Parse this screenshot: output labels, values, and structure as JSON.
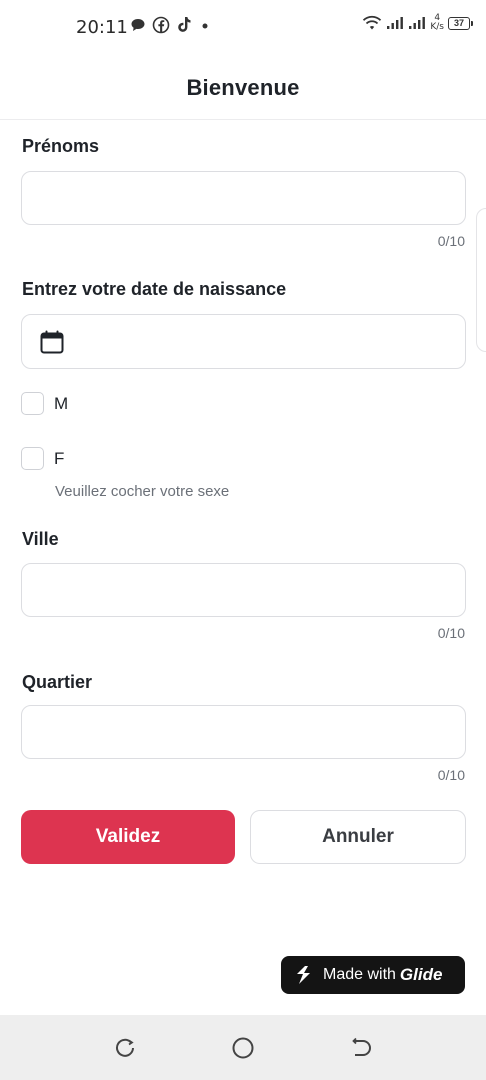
{
  "status_bar": {
    "time": "20:11",
    "speed_value": "4",
    "speed_unit": "K/s",
    "battery": "37",
    "icons": [
      "chat-bubble-icon",
      "facebook-icon",
      "tiktok-icon",
      "dot-icon",
      "wifi-icon",
      "signal-icon",
      "signal-icon-2"
    ]
  },
  "header": {
    "title": "Bienvenue"
  },
  "form": {
    "prenoms": {
      "label": "Prénoms",
      "value": "",
      "counter": "0/10"
    },
    "date": {
      "label": "Entrez votre date de naissance",
      "value": "",
      "icon": "calendar-icon"
    },
    "sexe": {
      "options": [
        {
          "label": "M",
          "checked": false
        },
        {
          "label": "F",
          "checked": false
        }
      ],
      "hint": "Veuillez cocher votre sexe"
    },
    "ville": {
      "label": "Ville",
      "value": "",
      "counter": "0/10"
    },
    "quartier": {
      "label": "Quartier",
      "value": "",
      "counter": "0/10"
    }
  },
  "actions": {
    "submit_label": "Validez",
    "cancel_label": "Annuler"
  },
  "badge": {
    "made_with": "Made with",
    "brand": "Glide",
    "icon": "glide-logo-icon"
  },
  "nav": {
    "icons": [
      "recent-apps-icon",
      "home-icon",
      "back-icon"
    ]
  },
  "colors": {
    "primary": "#dd3450",
    "border": "#dcdde1",
    "muted_text": "#6b7078"
  }
}
